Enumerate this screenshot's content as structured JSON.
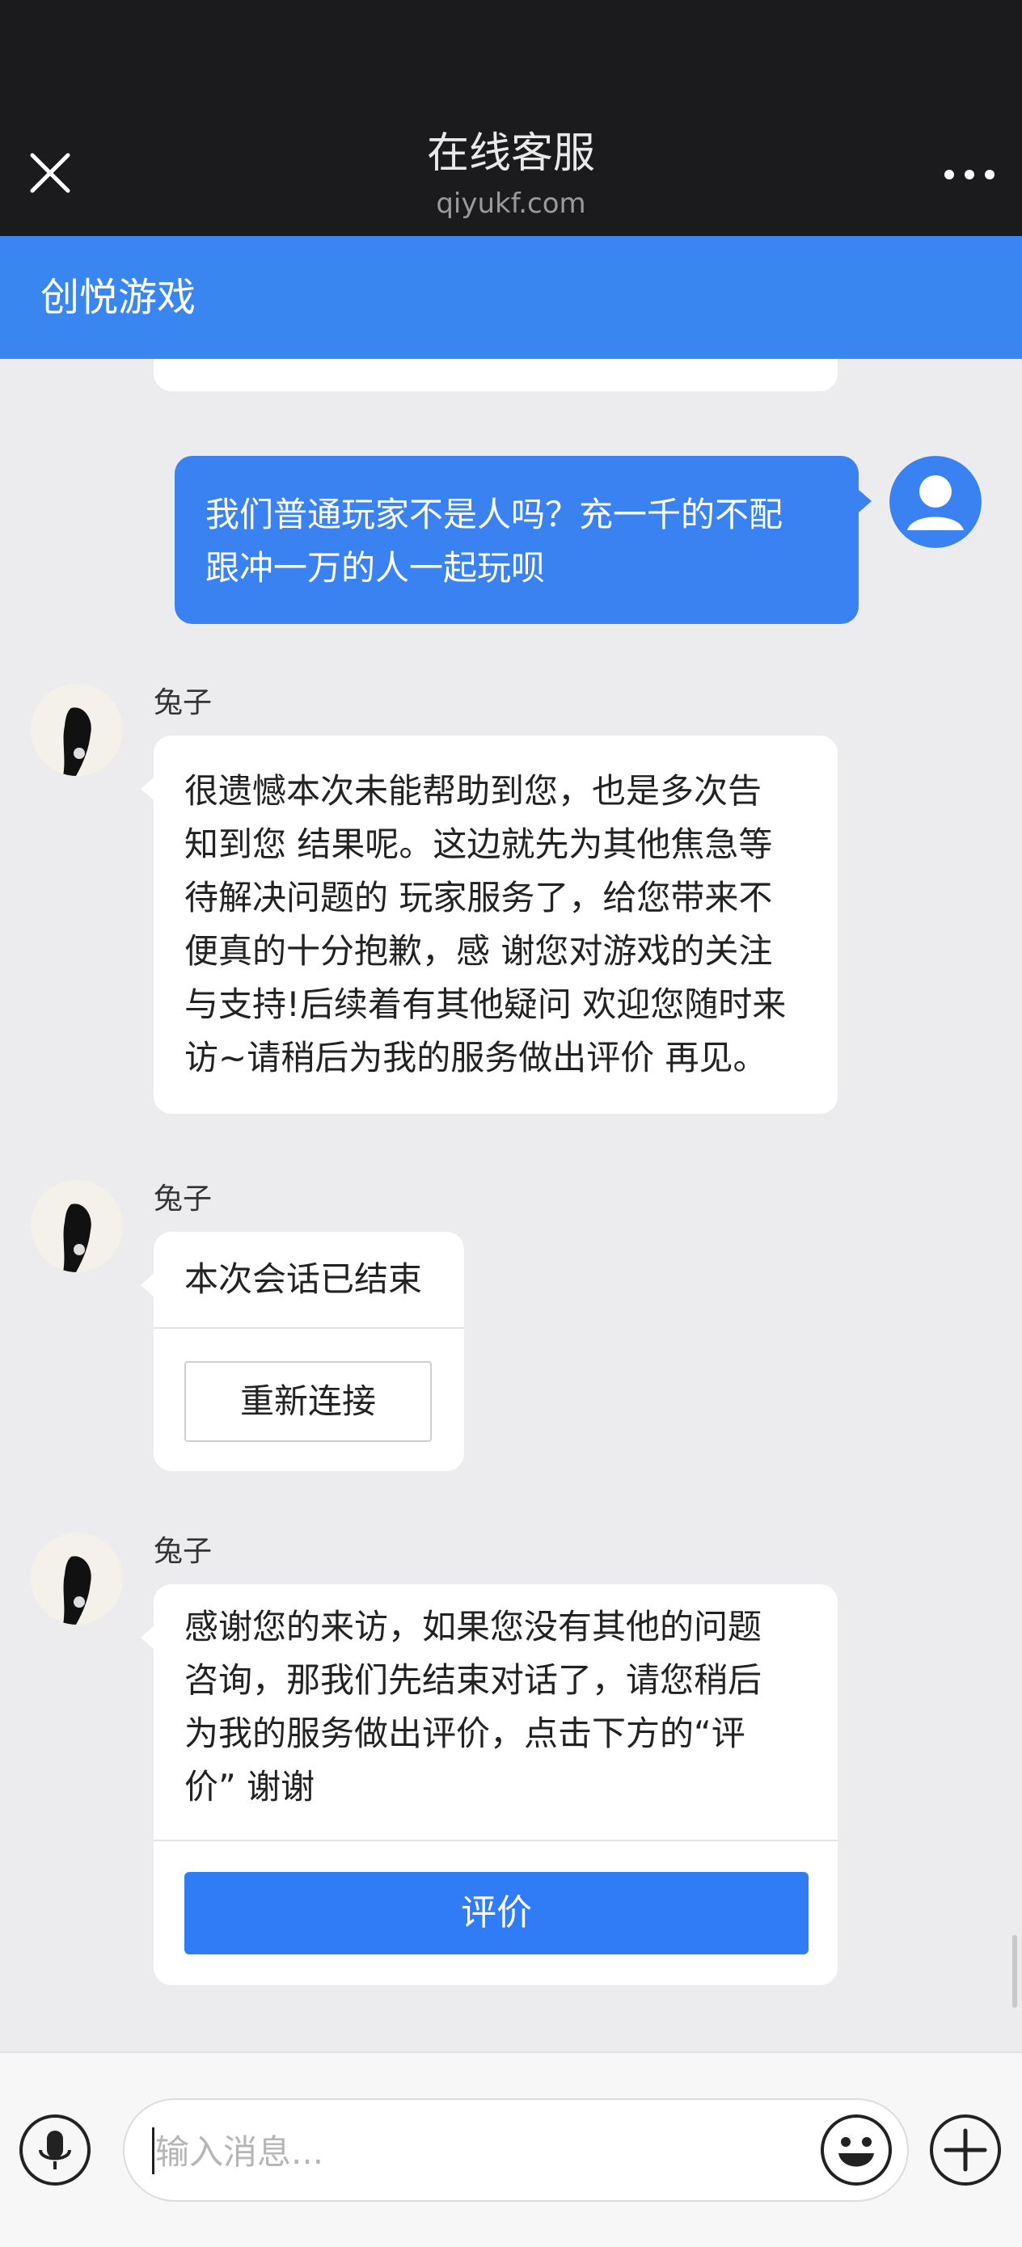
{
  "header": {
    "title": "在线客服",
    "subtitle": "qiyukf.com",
    "close_icon": "close-icon",
    "more_icon": "more-dots-icon"
  },
  "brand": {
    "name": "创悦游戏"
  },
  "messages": {
    "user_message": {
      "line1": "我们普通玩家不是人吗？充一千的不配",
      "line2": "跟冲一万的人一起玩呗"
    },
    "agent_message_1": {
      "sender": "兔子",
      "lines": [
        "很遗憾本次未能帮助到您，也是多次告",
        "知到您 结果呢。这边就先为其他焦急等",
        "待解决问题的 玩家服务了，给您带来不",
        "便真的十分抱歉，感 谢您对游戏的关注",
        "与支持!后续着有其他疑问 欢迎您随时来",
        "访~请稍后为我的服务做出评价 再见。"
      ]
    },
    "agent_message_2": {
      "sender": "兔子",
      "text": "本次会话已结束",
      "button": "重新连接"
    },
    "agent_message_3": {
      "sender": "兔子",
      "lines": [
        "感谢您的来访，如果您没有其他的问题",
        "咨询，那我们先结束对话了，请您稍后",
        "为我的服务做出评价，点击下方的“评",
        "价” 谢谢"
      ],
      "button": "评价"
    }
  },
  "input_bar": {
    "placeholder": "输入消息...",
    "voice_icon": "microphone-icon",
    "emoji_icon": "emoji-icon",
    "plus_icon": "plus-icon"
  },
  "colors": {
    "header_bg": "#1b1b1d",
    "brand_bar": "#3a86f0",
    "user_bubble": "#3a82f2",
    "action_button": "#2f7cf6",
    "chat_bg": "#ececee"
  }
}
